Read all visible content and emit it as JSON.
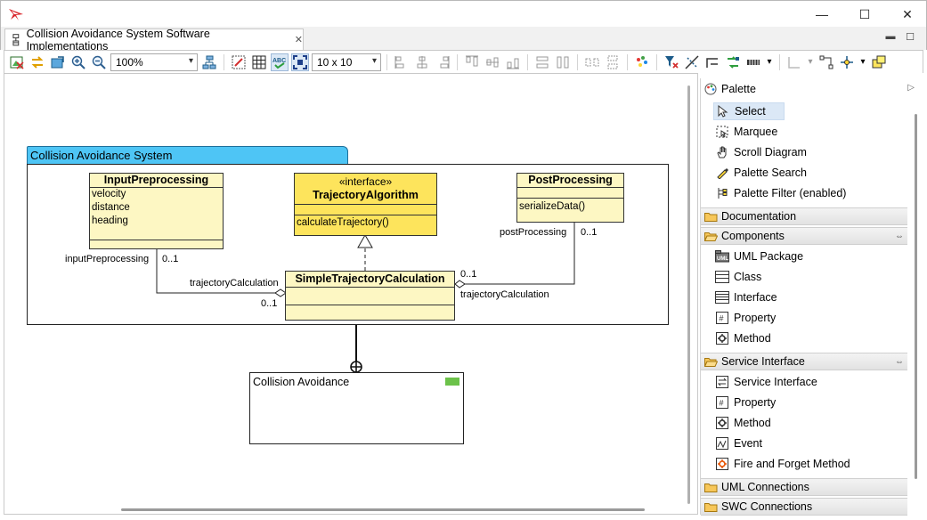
{
  "window": {
    "controls": {
      "minimize": "—",
      "maximize": "☐",
      "close": "✕"
    }
  },
  "editor_tab": {
    "title": "Collision Avoidance System Software Implementations",
    "close": "✕",
    "min": "▬",
    "max": "☐"
  },
  "toolbar": {
    "zoom_value": "100%",
    "grid_value": "10 x 10"
  },
  "diagram": {
    "package_name": "Collision Avoidance System",
    "classes": [
      {
        "name": "InputPreprocessing",
        "attributes": [
          "velocity",
          "distance",
          "heading"
        ],
        "operations": []
      },
      {
        "stereotype": "«interface»",
        "name": "TrajectoryAlgorithm",
        "attributes": [],
        "operations": [
          "calculateTrajectory()"
        ]
      },
      {
        "name": "PostProcessing",
        "attributes": [],
        "operations": [
          "serializeData()"
        ]
      },
      {
        "name": "SimpleTrajectoryCalculation",
        "attributes": [],
        "operations": []
      }
    ],
    "labels": {
      "inputPreprocessing": "inputPreprocessing",
      "mult_left_top": "0..1",
      "trajCalc_left": "trajectoryCalculation",
      "mult_left_bottom": "0..1",
      "mult_right_top": "0..1",
      "trajCalc_right": "trajectoryCalculation",
      "postProcessing": "postProcessing",
      "mult_post": "0..1"
    },
    "component_name": "Collision Avoidance",
    "component_flag_color": "#6cc24a"
  },
  "palette": {
    "title": "Palette",
    "tools": [
      {
        "label": "Select",
        "icon": "cursor-icon",
        "selected": true
      },
      {
        "label": "Marquee",
        "icon": "marquee-icon"
      },
      {
        "label": "Scroll Diagram",
        "icon": "hand-icon"
      },
      {
        "label": "Palette Search",
        "icon": "search-pen-icon"
      },
      {
        "label": "Palette Filter (enabled)",
        "icon": "filter-icon"
      }
    ],
    "drawers": {
      "documentation": "Documentation",
      "components": "Components",
      "service_interface": "Service Interface",
      "uml_connections": "UML Connections",
      "swc_connections": "SWC Connections"
    },
    "components_items": [
      "UML Package",
      "Class",
      "Interface",
      "Property",
      "Method"
    ],
    "service_items": [
      "Service Interface",
      "Property",
      "Method",
      "Event",
      "Fire and Forget Method"
    ]
  },
  "colors": {
    "package_tab": "#4ec5f5",
    "class_fill": "#fdf7c3",
    "interface_fill": "#fde45c",
    "selection": "#dbe8f6"
  }
}
